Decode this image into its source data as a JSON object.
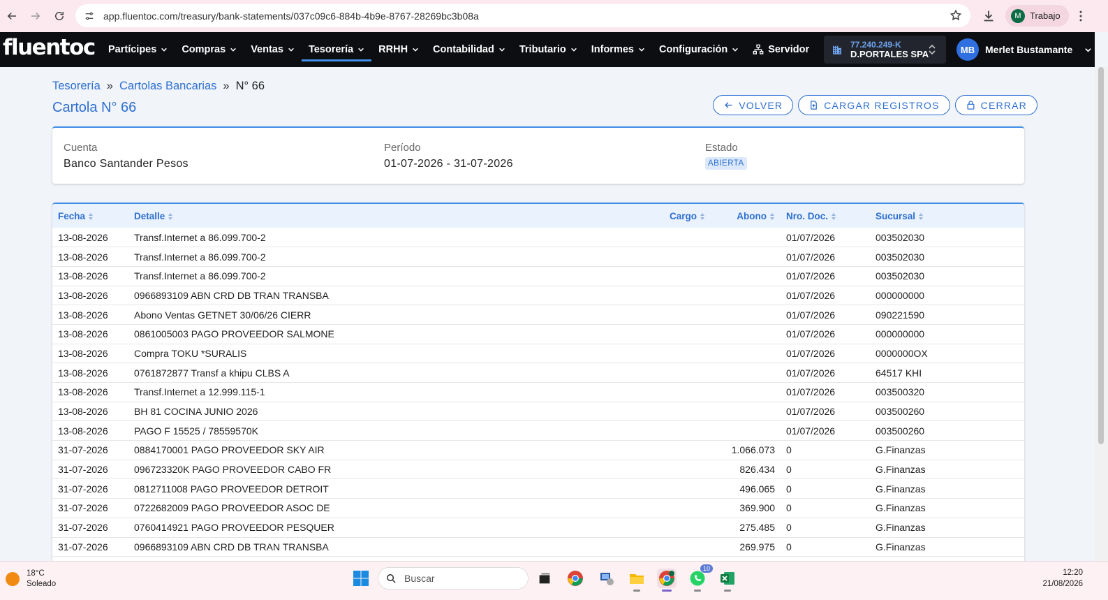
{
  "browser": {
    "url": "app.fluentoc.com/treasury/bank-statements/037c09c6-884b-4b9e-8767-28269bc3b08a",
    "profile_initial": "M",
    "profile_name": "Trabajo"
  },
  "app": {
    "logo": "fluentoc",
    "menu": [
      {
        "label": "Partícipes",
        "chevron": true
      },
      {
        "label": "Compras",
        "chevron": true
      },
      {
        "label": "Ventas",
        "chevron": true
      },
      {
        "label": "Tesorería",
        "chevron": true,
        "active": true
      },
      {
        "label": "RRHH",
        "chevron": true
      },
      {
        "label": "Contabilidad",
        "chevron": true
      },
      {
        "label": "Tributario",
        "chevron": true
      },
      {
        "label": "Informes",
        "chevron": true
      },
      {
        "label": "Configuración",
        "chevron": true
      }
    ],
    "server_label": "Servidor",
    "company_rut": "77.240.249-K",
    "company_name": "D.PORTALES SPA",
    "user_initials": "MB",
    "user_name": "Merlet Bustamante"
  },
  "breadcrumb": {
    "items": [
      "Tesorería",
      "Cartolas Bancarias"
    ],
    "separator": "»",
    "current": "N° 66"
  },
  "page": {
    "title": "Cartola N° 66",
    "buttons": {
      "back": "VOLVER",
      "upload": "CARGAR REGISTROS",
      "close": "CERRAR"
    }
  },
  "info": {
    "account_label": "Cuenta",
    "account_value": "Banco Santander Pesos",
    "period_label": "Período",
    "period_value": "01-07-2026 - 31-07-2026",
    "status_label": "Estado",
    "status_value": "ABIERTA"
  },
  "table": {
    "headers": {
      "fecha": "Fecha",
      "detalle": "Detalle",
      "cargo": "Cargo",
      "abono": "Abono",
      "nro_doc": "Nro. Doc.",
      "sucursal": "Sucursal"
    },
    "rows": [
      [
        "13-08-2026",
        "Transf.Internet a 86.099.700-2",
        "",
        "",
        "01/07/2026",
        "003502030"
      ],
      [
        "13-08-2026",
        "Transf.Internet a 86.099.700-2",
        "",
        "",
        "01/07/2026",
        "003502030"
      ],
      [
        "13-08-2026",
        "Transf.Internet a 86.099.700-2",
        "",
        "",
        "01/07/2026",
        "003502030"
      ],
      [
        "13-08-2026",
        "0966893109 ABN CRD DB TRAN TRANSBA",
        "",
        "",
        "01/07/2026",
        "000000000"
      ],
      [
        "13-08-2026",
        "Abono Ventas GETNET 30/06/26 CIERR",
        "",
        "",
        "01/07/2026",
        "090221590"
      ],
      [
        "13-08-2026",
        "0861005003 PAGO PROVEEDOR SALMONE",
        "",
        "",
        "01/07/2026",
        "000000000"
      ],
      [
        "13-08-2026",
        "Compra TOKU *SURALIS",
        "",
        "",
        "01/07/2026",
        "0000000OX"
      ],
      [
        "13-08-2026",
        "0761872877 Transf a khipu CLBS A",
        "",
        "",
        "01/07/2026",
        "64517 KHI"
      ],
      [
        "13-08-2026",
        "Transf.Internet a 12.999.115-1",
        "",
        "",
        "01/07/2026",
        "003500320"
      ],
      [
        "13-08-2026",
        "BH 81 COCINA JUNIO 2026",
        "",
        "",
        "01/07/2026",
        "003500260"
      ],
      [
        "13-08-2026",
        "PAGO F 15525 / 78559570K",
        "",
        "",
        "01/07/2026",
        "003500260"
      ],
      [
        "31-07-2026",
        "0884170001 PAGO PROVEEDOR SKY AIR",
        "",
        "1.066.073",
        "0",
        "G.Finanzas"
      ],
      [
        "31-07-2026",
        "096723320K PAGO PROVEEDOR CABO FR",
        "",
        "826.434",
        "0",
        "G.Finanzas"
      ],
      [
        "31-07-2026",
        "0812711008 PAGO PROVEEDOR DETROIT",
        "",
        "496.065",
        "0",
        "G.Finanzas"
      ],
      [
        "31-07-2026",
        "0722682009 PAGO PROVEEDOR ASOC DE",
        "",
        "369.900",
        "0",
        "G.Finanzas"
      ],
      [
        "31-07-2026",
        "0760414921 PAGO PROVEEDOR PESQUER",
        "",
        "275.485",
        "0",
        "G.Finanzas"
      ],
      [
        "31-07-2026",
        "0966893109 ABN CRD DB TRAN TRANSBA",
        "",
        "269.975",
        "0",
        "G.Finanzas"
      ]
    ]
  },
  "taskbar": {
    "temperature": "18°C",
    "weather": "Soleado",
    "search_placeholder": "Buscar",
    "whatsapp_badge": "10",
    "time": "12:20",
    "date": "21/08/2026"
  }
}
